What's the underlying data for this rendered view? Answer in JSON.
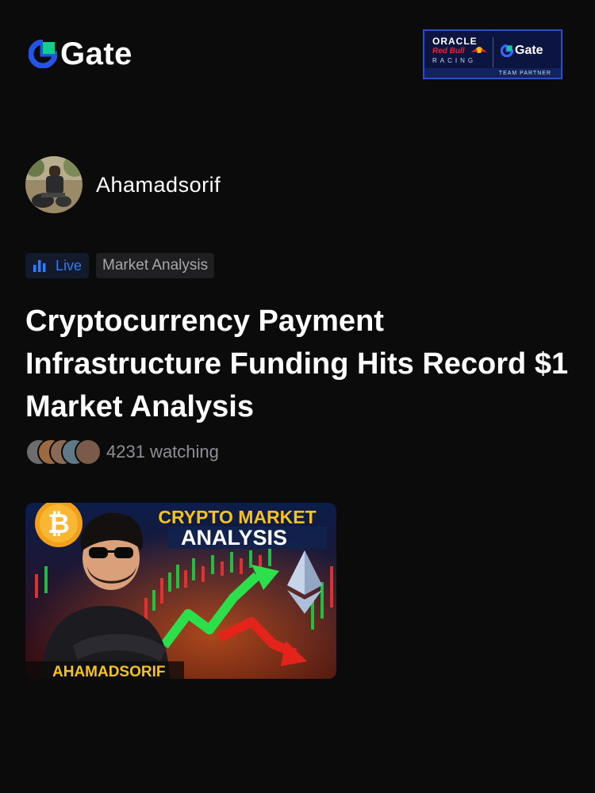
{
  "brand": {
    "name": "Gate",
    "accent": "#2354e6",
    "mark_color": "#0fcf8f"
  },
  "partner": {
    "line1": "ORACLE",
    "line2": "Red Bull",
    "line3": "RACING",
    "brand": "Gate",
    "badge": "TEAM PARTNER"
  },
  "author": {
    "name": "Ahamadsorif"
  },
  "tags": [
    {
      "label": "Live",
      "icon": "bar-chart-icon",
      "color": "#2f7cf6"
    },
    {
      "label": "Market Analysis"
    }
  ],
  "title": "Cryptocurrency Payment Infrastructure Funding Hits Record $1 Market Analysis",
  "watching": {
    "count": "4231",
    "label": "watching",
    "text": "4231 watching"
  },
  "thumbnail": {
    "headline_top": "CRYPTO MARKET",
    "headline_bottom": "ANALYSIS",
    "footer": "AHAMADSORIF"
  }
}
